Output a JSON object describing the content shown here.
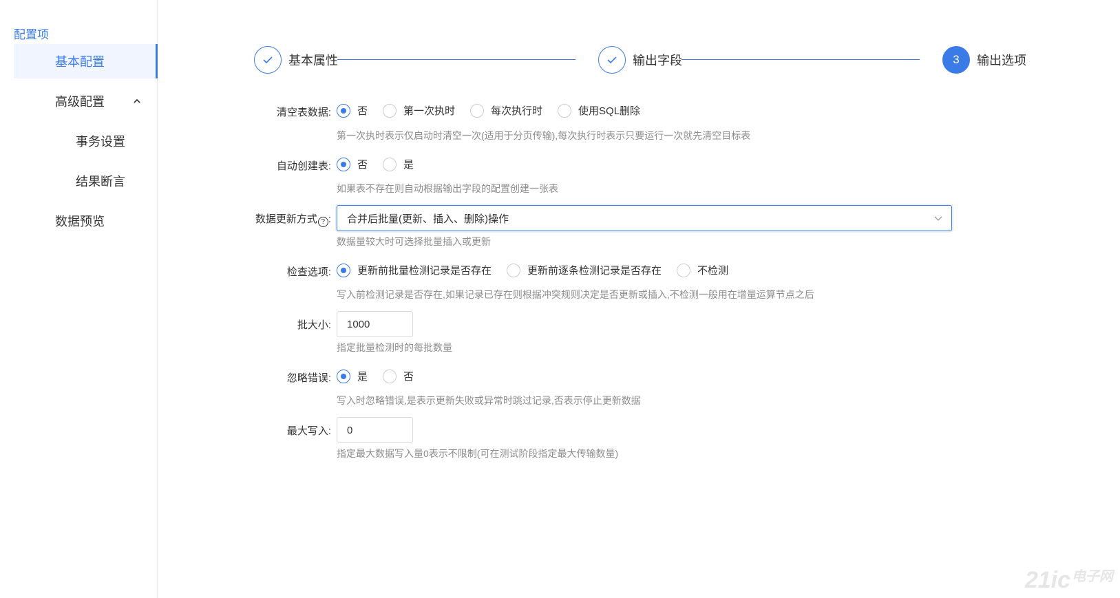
{
  "sidebar": {
    "title": "配置项",
    "items": [
      {
        "label": "基本配置",
        "active": true
      },
      {
        "label": "高级配置",
        "expanded": true
      },
      {
        "label": "事务设置"
      },
      {
        "label": "结果断言"
      },
      {
        "label": "数据预览"
      }
    ]
  },
  "steps": [
    {
      "label": "基本属性",
      "status": "done"
    },
    {
      "label": "输出字段",
      "status": "done"
    },
    {
      "label": "输出选项",
      "status": "current",
      "number": "3"
    }
  ],
  "form": {
    "clear_table": {
      "label": "清空表数据:",
      "options": [
        "否",
        "第一次执时",
        "每次执行时",
        "使用SQL删除"
      ],
      "selected": "否",
      "hint": "第一次执时表示仅启动时清空一次(适用于分页传输),每次执行时表示只要运行一次就先清空目标表"
    },
    "auto_create": {
      "label": "自动创建表:",
      "options": [
        "否",
        "是"
      ],
      "selected": "否",
      "hint": "如果表不存在则自动根据输出字段的配置创建一张表"
    },
    "update_mode": {
      "label": "数据更新方式",
      "help": "?",
      "label_suffix": ":",
      "value": "合并后批量(更新、插入、删除)操作",
      "hint": "数据量较大时可选择批量插入或更新"
    },
    "check_option": {
      "label": "检查选项:",
      "options": [
        "更新前批量检测记录是否存在",
        "更新前逐条检测记录是否存在",
        "不检测"
      ],
      "selected": "更新前批量检测记录是否存在",
      "hint": "写入前检测记录是否存在,如果记录已存在则根据冲突规则决定是否更新或插入,不检测一般用在增量运算节点之后"
    },
    "batch_size": {
      "label": "批大小:",
      "value": "1000",
      "hint": "指定批量检测时的每批数量"
    },
    "ignore_error": {
      "label": "忽略错误:",
      "options": [
        "是",
        "否"
      ],
      "selected": "是",
      "hint": "写入时忽略错误,是表示更新失败或异常时跳过记录,否表示停止更新数据"
    },
    "max_write": {
      "label": "最大写入:",
      "value": "0",
      "hint": "指定最大数据写入量0表示不限制(可在测试阶段指定最大传输数量)"
    }
  },
  "watermark": {
    "text": "21ic",
    "cn": "电子网"
  },
  "colors": {
    "accent": "#3b7be8",
    "hint": "#8c8c8c",
    "border": "#d9d9d9"
  }
}
